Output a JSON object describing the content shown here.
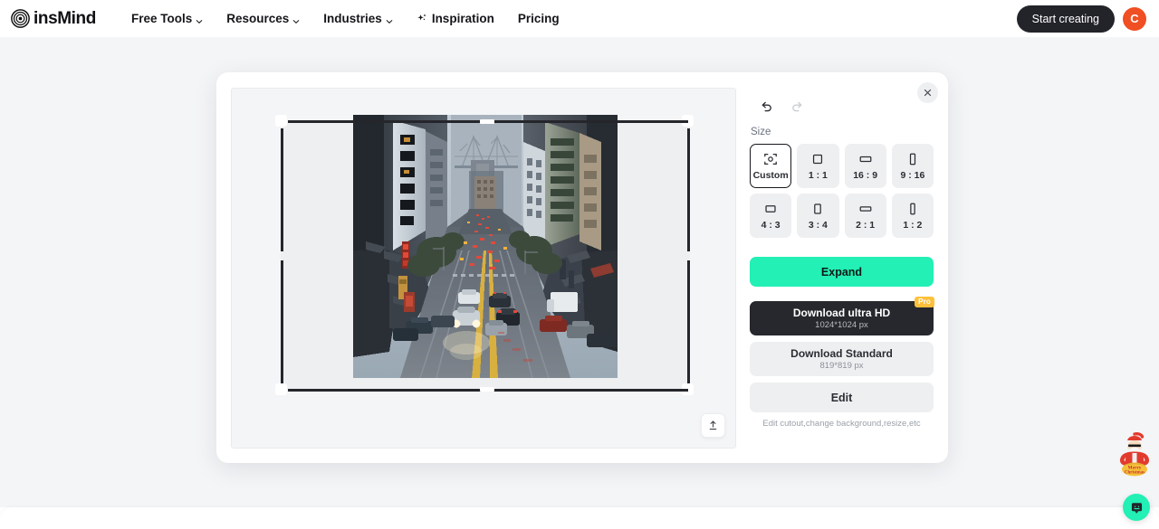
{
  "header": {
    "logo_text": "insMind",
    "logo_icon": "insmind-spiral-logo-icon",
    "nav": [
      {
        "label": "Free Tools",
        "has_caret": true,
        "icon": "chevron-down-icon"
      },
      {
        "label": "Resources",
        "has_caret": true,
        "icon": "chevron-down-icon"
      },
      {
        "label": "Industries",
        "has_caret": true,
        "icon": "chevron-down-icon"
      },
      {
        "label": "Inspiration",
        "has_caret": false,
        "icon": "sparkle-icon"
      },
      {
        "label": "Pricing",
        "has_caret": false,
        "icon": ""
      }
    ],
    "start_creating_label": "Start creating",
    "avatar_initial": "C",
    "avatar_color": "#f04e23"
  },
  "modal": {
    "close_icon": "close-icon",
    "canvas": {
      "upload_icon": "upload-icon",
      "photo_alt": "San Francisco downtown street at dusk with Bay Bridge",
      "crop_handle_icon": "crop-corner-handle-icon"
    },
    "panel": {
      "undo_icon": "undo-icon",
      "redo_icon": "redo-icon",
      "undo_enabled": true,
      "redo_enabled": false,
      "size_label": "Size",
      "sizes": [
        {
          "label": "Custom",
          "icon": "custom-crop-icon",
          "ratio": "custom",
          "selected": true
        },
        {
          "label": "1 : 1",
          "icon": "square-icon",
          "ratio": "1:1",
          "selected": false
        },
        {
          "label": "16 : 9",
          "icon": "landscape-wide-icon",
          "ratio": "16:9",
          "selected": false
        },
        {
          "label": "9 : 16",
          "icon": "portrait-tall-icon",
          "ratio": "9:16",
          "selected": false
        },
        {
          "label": "4 : 3",
          "icon": "landscape-icon",
          "ratio": "4:3",
          "selected": false
        },
        {
          "label": "3 : 4",
          "icon": "portrait-icon",
          "ratio": "3:4",
          "selected": false
        },
        {
          "label": "2 : 1",
          "icon": "landscape-wide-icon",
          "ratio": "2:1",
          "selected": false
        },
        {
          "label": "1 : 2",
          "icon": "portrait-tall-icon",
          "ratio": "1:2",
          "selected": false
        }
      ],
      "expand_label": "Expand",
      "expand_color": "#22f0b4",
      "download_hd": {
        "title": "Download ultra HD",
        "subtitle": "1024*1024 px",
        "badge": "Pro",
        "badge_color": "#ffc13c"
      },
      "download_standard": {
        "title": "Download Standard",
        "subtitle": "819*819 px"
      },
      "edit_label": "Edit",
      "edit_hint": "Edit cutout,change background,resize,etc"
    }
  },
  "widgets": {
    "santa_promo_icon": "santa-christmas-promo-icon",
    "santa_promo_text": "Merry Christmas",
    "chat_icon": "chat-bubble-icon",
    "chat_color": "#22f0b4"
  }
}
